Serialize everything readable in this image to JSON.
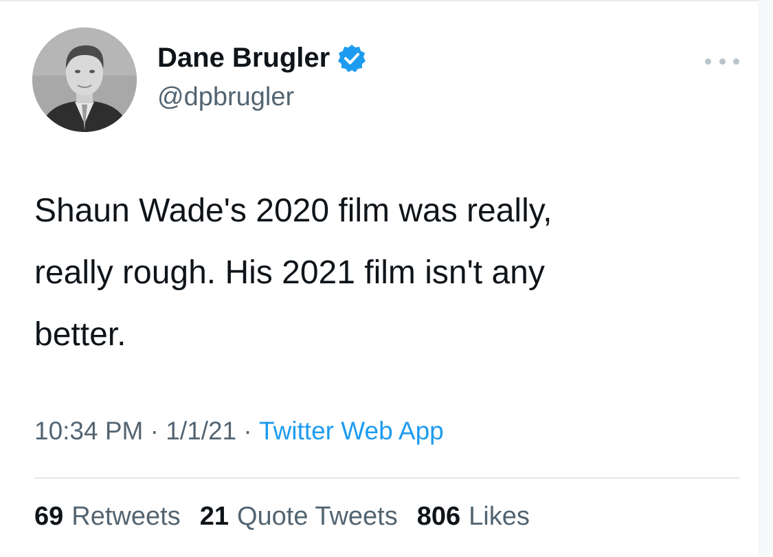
{
  "tweet": {
    "author": {
      "display_name": "Dane Brugler",
      "handle": "@dpbrugler",
      "verified": true,
      "verified_icon": "verified-badge-icon",
      "avatar_icon": "profile-photo"
    },
    "more_icon": "more-options-icon",
    "text": "Shaun Wade's 2020 film was really,\nreally rough. His 2021 film isn't any\nbetter.",
    "meta": {
      "time": "10:34 PM",
      "separator": "·",
      "date": "1/1/21",
      "source": "Twitter Web App"
    },
    "stats": {
      "retweets_count": "69",
      "retweets_label": "Retweets",
      "quotes_count": "21",
      "quotes_label": "Quote Tweets",
      "likes_count": "806",
      "likes_label": "Likes"
    }
  },
  "colors": {
    "text_primary": "#0f1419",
    "text_secondary": "#536471",
    "accent": "#1d9bf0",
    "divider": "#e1e8ed"
  }
}
